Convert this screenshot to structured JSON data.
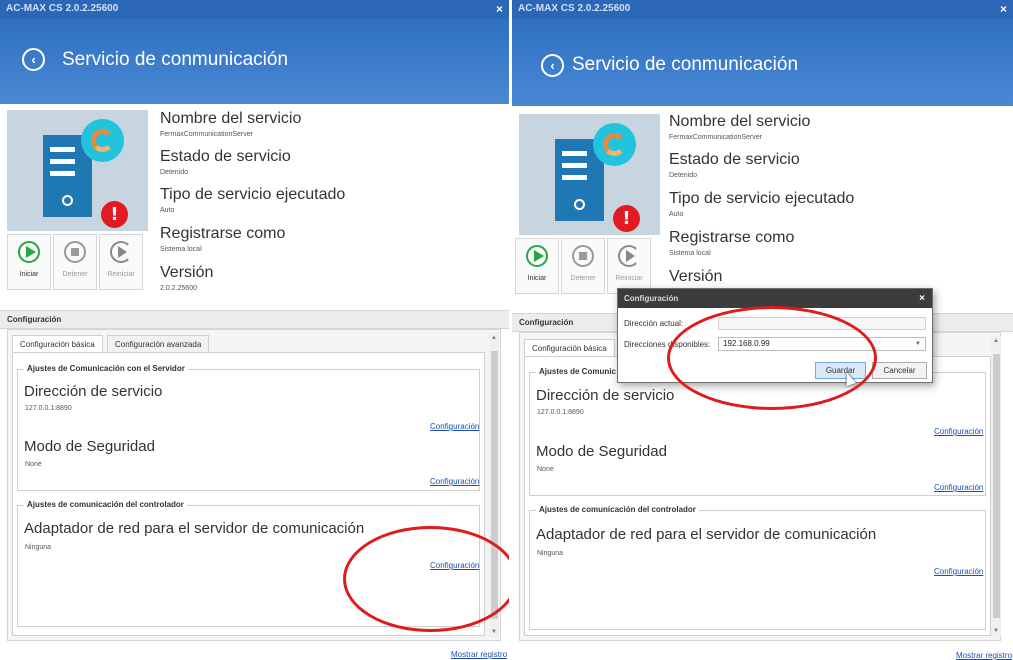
{
  "window": {
    "app_title": "AC-MAX CS 2.0.2.25600",
    "close_glyph": "×",
    "back_glyph": "‹",
    "page_title": "Servicio de conmunicación"
  },
  "service": {
    "name_label": "Nombre del servicio",
    "name_value": "FermaxCommunicationServer",
    "state_label": "Estado de servicio",
    "state_value": "Detenido",
    "type_label": "Tipo de servicio ejecutado",
    "type_value": "Auto",
    "register_label": "Registrarse como",
    "register_value": "Sistema local",
    "version_label": "Versión",
    "version_value": "2.0.2.25600",
    "warning_glyph": "!"
  },
  "controls": {
    "start": "Iniciar",
    "stop": "Detener",
    "restart": "Reiniciar"
  },
  "configuration": {
    "section_title": "Configuración",
    "tabs": [
      "Configuración básica",
      "Configuración avanzada"
    ],
    "server_group_title": "Ajustes de Comunicación con el Servidor",
    "service_address_label": "Dirección de servicio",
    "service_address_value": "127.0.0.1:8890",
    "security_mode_label": "Modo de Seguridad",
    "security_mode_value": "None",
    "controller_group_title": "Ajustes de comunicación del controlador",
    "network_adapter_label": "Adaptador de red para el servidor de comunicación",
    "network_adapter_value": "Ninguna",
    "config_link": "Configuración",
    "right_server_group_title": "Ajustes de Comunic",
    "scroll_up_glyph": "▲",
    "scroll_down_glyph": "▼"
  },
  "footer": {
    "show_log_link": "Mostrar registro"
  },
  "dialog": {
    "title": "Configuración",
    "current_address_label": "Dirección actual:",
    "current_address_value": "",
    "available_addresses_label": "Direcciones disponibles:",
    "available_addresses_selected": "192.168.0.99",
    "dropdown_glyph": "▼",
    "save_button": "Guardar",
    "cancel_button": "Cancelar"
  },
  "colors": {
    "header_blue": "#2e6fbf",
    "accent_cyan": "#22c3dd",
    "warning_red": "#e21b23",
    "annotation_red": "#e01b1b",
    "link_blue": "#1a4fb4"
  }
}
